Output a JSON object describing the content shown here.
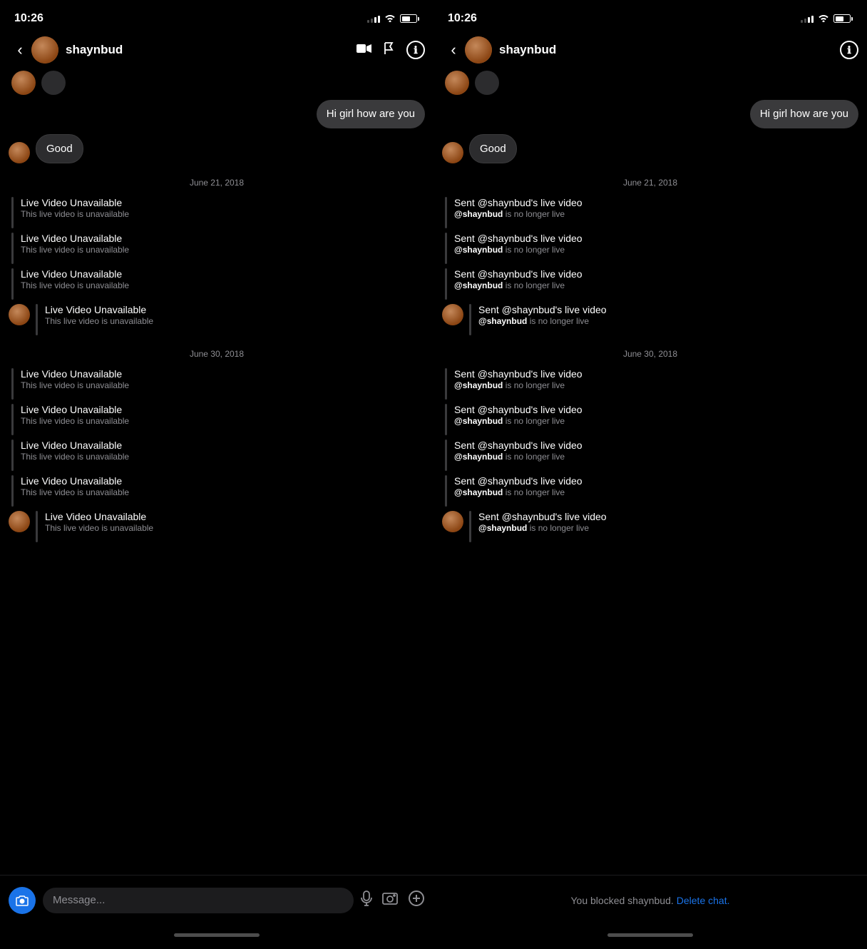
{
  "left_screen": {
    "status": {
      "time": "10:26",
      "location": "↗"
    },
    "nav": {
      "back": "‹",
      "username": "shaynbud",
      "icons": {
        "video": "video",
        "flag": "flag",
        "info": "ℹ"
      }
    },
    "messages": [
      {
        "type": "sent",
        "text": "Hi girl how are you"
      },
      {
        "type": "received",
        "text": "Good"
      }
    ],
    "date_sep_1": "June 21, 2018",
    "live_videos_1": [
      {
        "title": "Live Video Unavailable",
        "sub": "This live video is unavailable",
        "has_avatar": false
      },
      {
        "title": "Live Video Unavailable",
        "sub": "This live video is unavailable",
        "has_avatar": false
      },
      {
        "title": "Live Video Unavailable",
        "sub": "This live video is unavailable",
        "has_avatar": false
      },
      {
        "title": "Live Video Unavailable",
        "sub": "This live video is unavailable",
        "has_avatar": true
      }
    ],
    "date_sep_2": "June 30, 2018",
    "live_videos_2": [
      {
        "title": "Live Video Unavailable",
        "sub": "This live video is unavailable",
        "has_avatar": false
      },
      {
        "title": "Live Video Unavailable",
        "sub": "This live video is unavailable",
        "has_avatar": false
      },
      {
        "title": "Live Video Unavailable",
        "sub": "This live video is unavailable",
        "has_avatar": false
      },
      {
        "title": "Live Video Unavailable",
        "sub": "This live video is unavailable",
        "has_avatar": false
      },
      {
        "title": "Live Video Unavailable",
        "sub": "This live video is unavailable",
        "has_avatar": true
      }
    ],
    "input": {
      "placeholder": "Message..."
    }
  },
  "right_screen": {
    "status": {
      "time": "10:26",
      "location": "↗"
    },
    "nav": {
      "back": "‹",
      "username": "shaynbud",
      "icons": {
        "info": "ℹ"
      }
    },
    "messages": [
      {
        "type": "sent",
        "text": "Hi girl how are you"
      },
      {
        "type": "received",
        "text": "Good"
      }
    ],
    "date_sep_1": "June 21, 2018",
    "live_videos_1": [
      {
        "title": "Sent @shaynbud's live video",
        "sub_user": "@shaynbud",
        "sub_rest": " is no longer live",
        "has_avatar": false
      },
      {
        "title": "Sent @shaynbud's live video",
        "sub_user": "@shaynbud",
        "sub_rest": " is no longer live",
        "has_avatar": false
      },
      {
        "title": "Sent @shaynbud's live video",
        "sub_user": "@shaynbud",
        "sub_rest": " is no longer live",
        "has_avatar": false
      },
      {
        "title": "Sent @shaynbud's live video",
        "sub_user": "@shaynbud",
        "sub_rest": " is no longer live",
        "has_avatar": true
      }
    ],
    "date_sep_2": "June 30, 2018",
    "live_videos_2": [
      {
        "title": "Sent @shaynbud's live video",
        "sub_user": "@shaynbud",
        "sub_rest": " is no longer live",
        "has_avatar": false
      },
      {
        "title": "Sent @shaynbud's live video",
        "sub_user": "@shaynbud",
        "sub_rest": " is no longer live",
        "has_avatar": false
      },
      {
        "title": "Sent @shaynbud's live video",
        "sub_user": "@shaynbud",
        "sub_rest": " is no longer live",
        "has_avatar": false
      },
      {
        "title": "Sent @shaynbud's live video",
        "sub_user": "@shaynbud",
        "sub_rest": " is no longer live",
        "has_avatar": false
      },
      {
        "title": "Sent @shaynbud's live video",
        "sub_user": "@shaynbud",
        "sub_rest": " is no longer live",
        "has_avatar": true
      }
    ],
    "blocked_text": "You blocked shaynbud.",
    "delete_chat": "Delete chat."
  }
}
